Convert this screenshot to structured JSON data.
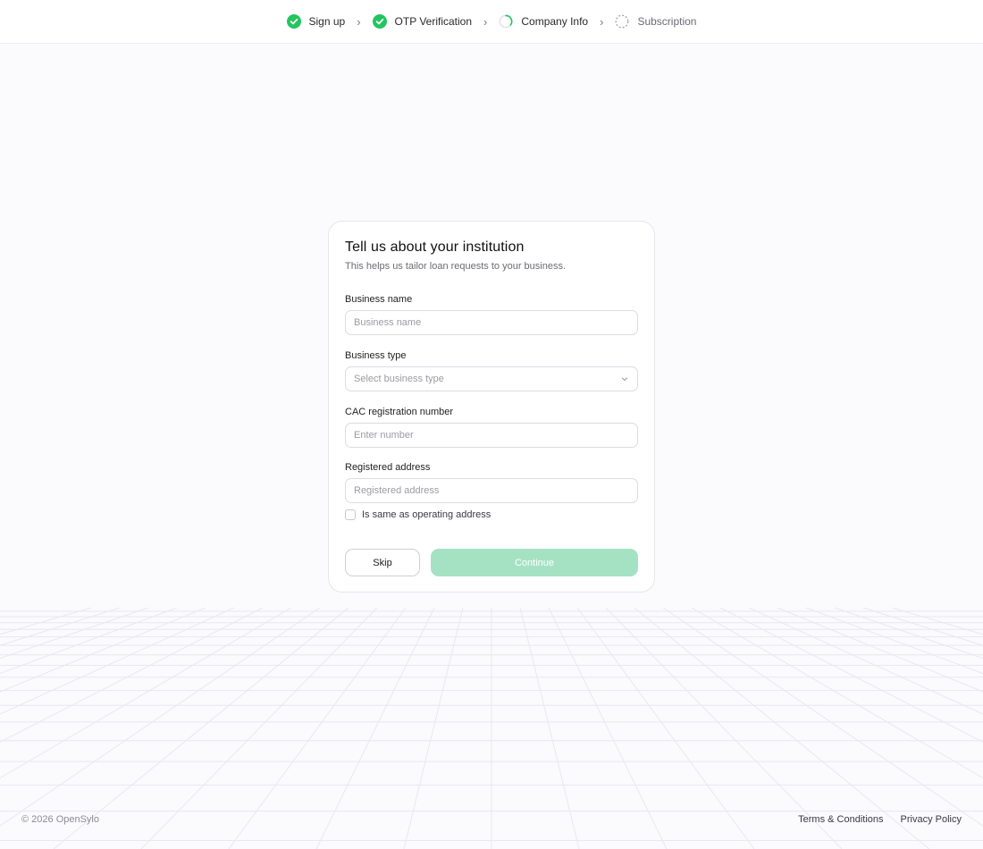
{
  "stepper": {
    "steps": [
      {
        "label": "Sign up",
        "status": "complete",
        "icon": "check-circle-icon"
      },
      {
        "label": "OTP Verification",
        "status": "complete",
        "icon": "check-circle-icon"
      },
      {
        "label": "Company Info",
        "status": "in-progress",
        "icon": "progress-ring-icon"
      },
      {
        "label": "Subscription",
        "status": "pending",
        "icon": "dashed-circle-icon"
      }
    ],
    "separator": "›"
  },
  "form": {
    "title": "Tell us about your institution",
    "subtitle": "This helps us tailor loan requests to your business.",
    "business_name": {
      "label": "Business name",
      "placeholder": "Business name",
      "value": ""
    },
    "business_type": {
      "label": "Business type",
      "placeholder": "Select business type",
      "value": ""
    },
    "cac_number": {
      "label": "CAC registration number",
      "placeholder": "Enter number",
      "value": ""
    },
    "registered_address": {
      "label": "Registered address",
      "placeholder": "Registered address",
      "value": ""
    },
    "same_address_checkbox": {
      "label": "Is same as operating address",
      "checked": false
    },
    "skip_label": "Skip",
    "continue_label": "Continue"
  },
  "footer": {
    "copyright": "© 2026 OpenSylo",
    "terms": "Terms & Conditions",
    "privacy": "Privacy Policy"
  },
  "colors": {
    "accent_green": "#22c55e",
    "continue_disabled": "#a5e2c4",
    "background": "#fbfafc"
  }
}
